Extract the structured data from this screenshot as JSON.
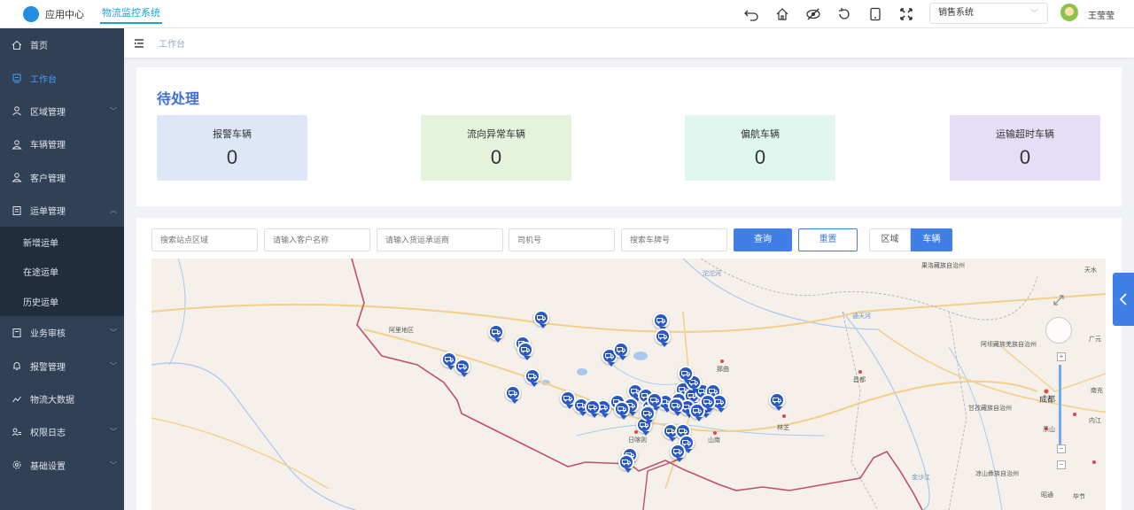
{
  "header": {
    "app_center": "应用中心",
    "system_tab": "物流监控系统",
    "system_select": "销售系统",
    "username": "王莹莹"
  },
  "sidebar": {
    "items": [
      {
        "label": "首页",
        "icon": "home-icon"
      },
      {
        "label": "工作台",
        "icon": "workbench-icon",
        "active": true
      },
      {
        "label": "区域管理",
        "icon": "area-icon",
        "has_arrow": true
      },
      {
        "label": "车辆管理",
        "icon": "vehicle-icon"
      },
      {
        "label": "客户管理",
        "icon": "customer-icon"
      },
      {
        "label": "运单管理",
        "icon": "waybill-icon",
        "has_arrow": true,
        "expanded": true
      }
    ],
    "sub_items": [
      "新增运单",
      "在途运单",
      "历史运单"
    ],
    "items_after": [
      {
        "label": "业务审核",
        "icon": "audit-icon",
        "has_arrow": true
      },
      {
        "label": "报警管理",
        "icon": "alarm-icon",
        "has_arrow": true
      },
      {
        "label": "物流大数据",
        "icon": "bigdata-icon"
      },
      {
        "label": "权限日志",
        "icon": "permission-icon",
        "has_arrow": true
      },
      {
        "label": "基础设置",
        "icon": "settings-icon",
        "has_arrow": true
      }
    ]
  },
  "breadcrumb": {
    "current": "工作台"
  },
  "pending": {
    "title": "待处理",
    "stats": [
      {
        "label": "报警车辆",
        "value": "0",
        "color": "#dde7f8"
      },
      {
        "label": "流向异常车辆",
        "value": "0",
        "color": "#e5f2dc"
      },
      {
        "label": "偏航车辆",
        "value": "0",
        "color": "#dff7ef"
      },
      {
        "label": "运输超时车辆",
        "value": "0",
        "color": "#e6def6"
      }
    ]
  },
  "filters": {
    "station_placeholder": "搜索站点区域",
    "customer_placeholder": "请输入客户名称",
    "carrier_placeholder": "请输入货运承运商",
    "driver_placeholder": "司机号",
    "plate_placeholder": "搜索车牌号",
    "query_label": "查询",
    "reset_label": "重置",
    "seg_area": "区域",
    "seg_vehicle": "车辆"
  },
  "map": {
    "labels": {
      "tuotuo": "沱沱河",
      "tongtian": "通天河",
      "ali": "阿里地区",
      "naqu": "那曲",
      "changdu": "昌都",
      "rikaze": "日喀则",
      "shannan": "山南",
      "linzhi": "林芝",
      "jinsha": "金沙江",
      "chengdu": "成都",
      "ganzi": "甘孜藏族自治州",
      "aba": "阿坝藏族羌族自治州",
      "leshan": "乐山",
      "liangshan": "凉山彝族自治州",
      "guoluo": "果洛藏族自治州",
      "tianshui": "天水",
      "guangyuan": "广元",
      "nanchong": "南充",
      "neijiang": "内江",
      "zhaotong": "昭通",
      "bijie": "毕节"
    }
  },
  "colors": {
    "sidebar_bg": "#304156",
    "primary": "#3f7fe6",
    "marker": "#2858c8"
  }
}
